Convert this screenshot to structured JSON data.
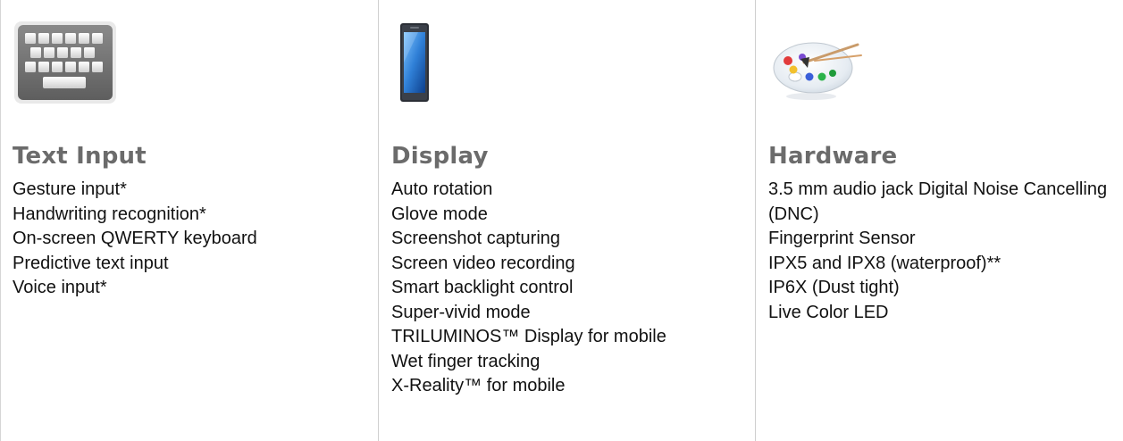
{
  "sections": [
    {
      "icon": "keyboard-icon",
      "title": "Text Input",
      "items": [
        "Gesture input*",
        "Handwriting recognition*",
        "On-screen QWERTY keyboard",
        "Predictive text input",
        "Voice input*"
      ]
    },
    {
      "icon": "smartphone-icon",
      "title": "Display",
      "items": [
        "Auto rotation",
        "Glove mode",
        "Screenshot capturing",
        "Screen video recording",
        "Smart backlight control",
        "Super-vivid mode",
        "TRILUMINOS™ Display for mobile",
        "Wet finger tracking",
        "X-Reality™ for mobile"
      ]
    },
    {
      "icon": "paint-palette-icon",
      "title": "Hardware",
      "items": [
        "3.5 mm audio jack Digital Noise Cancelling (DNC)",
        "Fingerprint Sensor",
        "IPX5 and IPX8 (waterproof)**",
        "IP6X (Dust tight)",
        "Live Color LED"
      ]
    }
  ],
  "colors": {
    "heading": "#6b6b6b",
    "text": "#111111",
    "divider": "#cfcfcf"
  }
}
